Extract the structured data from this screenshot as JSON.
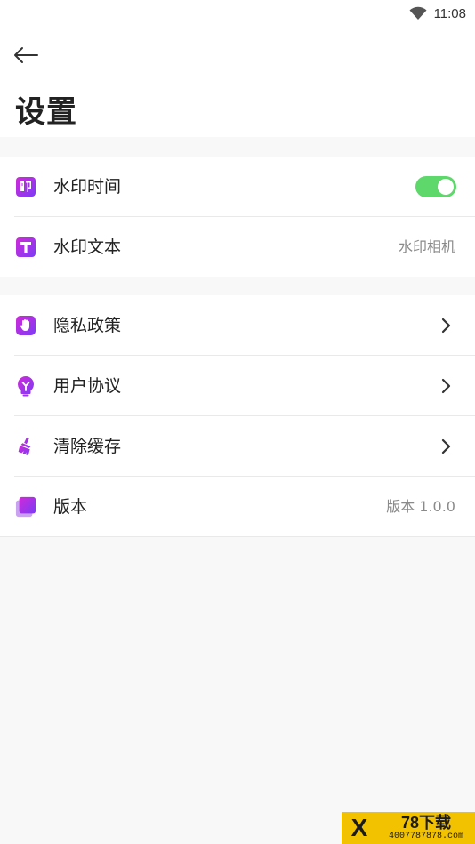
{
  "status_bar": {
    "time": "11:08",
    "wifi_icon": "wifi-icon"
  },
  "header": {
    "back_icon": "arrow-left-icon",
    "title": "设置"
  },
  "groups": [
    {
      "items": [
        {
          "icon": "watermark-time-icon",
          "label": "水印时间",
          "control": "toggle",
          "toggle_on": true
        },
        {
          "icon": "text-t-icon",
          "label": "水印文本",
          "value": "水印相机"
        }
      ]
    },
    {
      "items": [
        {
          "icon": "hand-icon",
          "label": "隐私政策",
          "control": "chevron"
        },
        {
          "icon": "bulb-icon",
          "label": "用户协议",
          "control": "chevron"
        },
        {
          "icon": "broom-icon",
          "label": "清除缓存",
          "control": "chevron"
        },
        {
          "icon": "stack-icon",
          "label": "版本",
          "value": "版本 1.0.0"
        }
      ]
    }
  ],
  "watermark_badge": {
    "brand": "78下载",
    "phone": "4007787878.com",
    "mark": "X"
  },
  "colors": {
    "accent_gradient_start": "#d02ad8",
    "accent_gradient_end": "#7b3cf5",
    "toggle_on": "#5ed86b"
  }
}
